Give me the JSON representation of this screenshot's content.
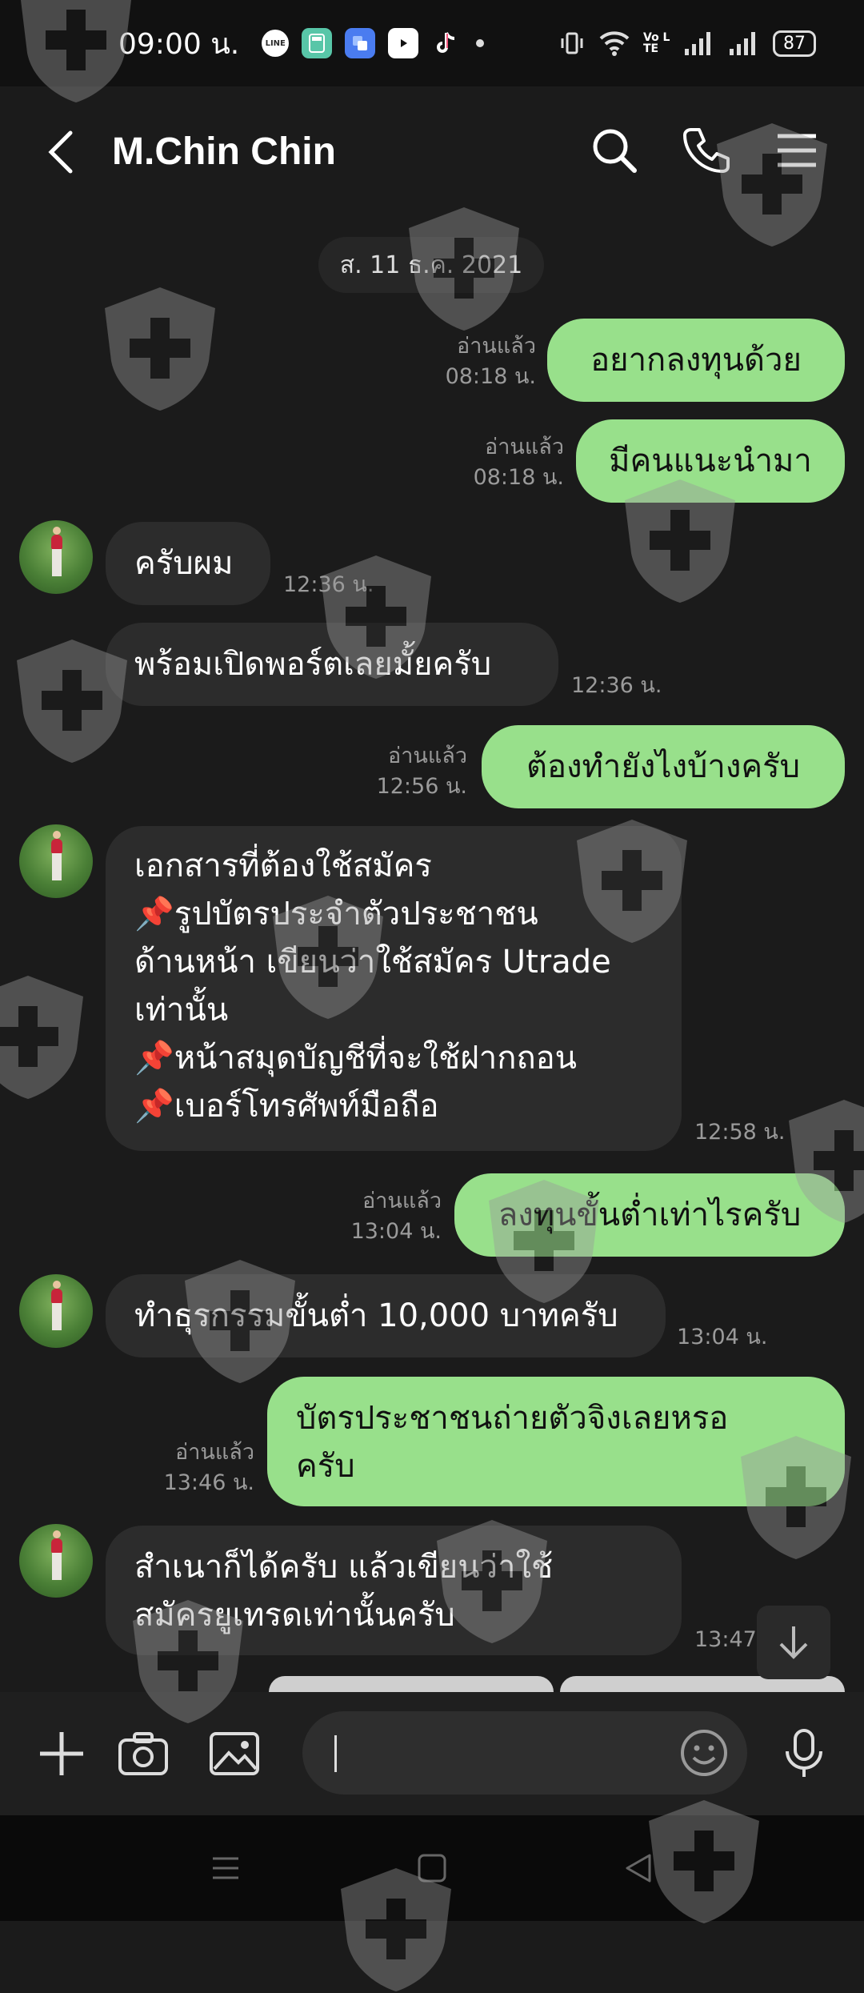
{
  "status_bar": {
    "time": "09:00 น.",
    "apps": [
      "LINE",
      "calculator",
      "google-app",
      "YouTube",
      "TikTok"
    ],
    "volte": "Vo LTE",
    "battery": "87"
  },
  "header": {
    "contact_name": "M.Chin Chin"
  },
  "chat": {
    "date": "ส. 11 ธ.ค. 2021",
    "messages": [
      {
        "side": "out",
        "text": "อยากลงทุนด้วย",
        "read": "อ่านแล้ว",
        "time": "08:18 น."
      },
      {
        "side": "out",
        "text": "มีคนแนะนำมา",
        "read": "อ่านแล้ว",
        "time": "08:18 น."
      },
      {
        "side": "in",
        "text": "ครับผม",
        "time": "12:36 น."
      },
      {
        "side": "in",
        "text": "พร้อมเปิดพอร์ตเลยมั้ยครับ",
        "time": "12:36 น."
      },
      {
        "side": "out",
        "text": "ต้องทำยังไงบ้างครับ",
        "read": "อ่านแล้ว",
        "time": "12:56 น."
      },
      {
        "side": "in",
        "lines": [
          "เอกสารที่ต้องใช้สมัคร",
          "📌รูปบัตรประจำตัวประชาชน",
          "ด้านหน้า เขียนว่าใช้สมัคร Utrade",
          "เท่านั้น",
          "📌หน้าสมุดบัญชีที่จะใช้ฝากถอน",
          "📌เบอร์โทรศัพท์มือถือ"
        ],
        "time": "12:58 น."
      },
      {
        "side": "out",
        "text": "ลงทุนขั้นต่ำเท่าไรครับ",
        "read": "อ่านแล้ว",
        "time": "13:04 น."
      },
      {
        "side": "in",
        "text": "ทำธุรกรรมขั้นต่ำ 10,000 บาทครับ",
        "time": "13:04 น."
      },
      {
        "side": "out",
        "lines": [
          "บัตรประชาชนถ่ายตัวจิงเลยหรอ",
          "ครับ"
        ],
        "read": "อ่านแล้ว",
        "time": "13:46 น."
      },
      {
        "side": "in",
        "lines": [
          "สำเนาก็ได้ครับ แล้วเขียนว่าใช้",
          "สมัครยูเทรดเท่านั้นครับ"
        ],
        "time": "13:47 น."
      }
    ]
  },
  "composer": {
    "value": "",
    "placeholder": ""
  },
  "colors": {
    "outgoing_bubble": "#98e08b",
    "incoming_bubble": "#2c2c2c",
    "background": "#1b1b1b"
  },
  "icons": {
    "header": [
      "back-arrow-icon",
      "search-icon",
      "phone-icon",
      "menu-icon"
    ],
    "composer": [
      "plus-icon",
      "camera-icon",
      "image-icon",
      "emoji-icon",
      "microphone-icon"
    ],
    "navbar": [
      "recents-icon",
      "home-icon",
      "back-icon"
    ],
    "watermark": "shield-cross-watermark"
  }
}
